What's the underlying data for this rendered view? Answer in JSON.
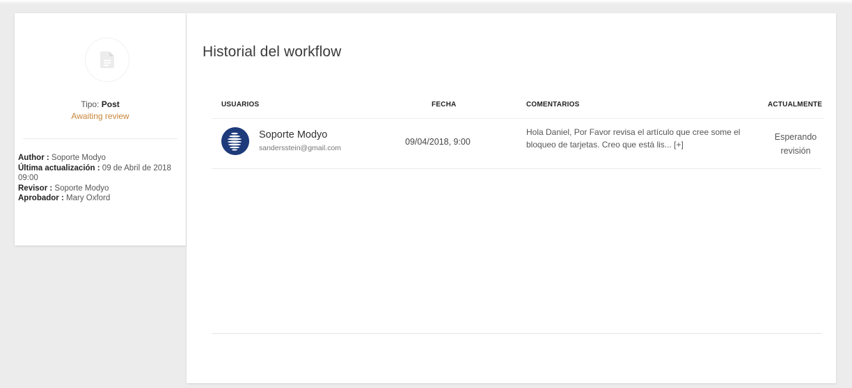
{
  "sidebar": {
    "tipo_label": "Tipo:",
    "tipo_value": "Post",
    "status": "Awaiting review",
    "meta": [
      {
        "label": "Author :",
        "value": "Soporte Modyo"
      },
      {
        "label": "Última actualización :",
        "value": "09 de Abril de 2018 09:00"
      },
      {
        "label": "Revisor :",
        "value": "Soporte Modyo"
      },
      {
        "label": "Aprobador :",
        "value": "Mary Oxford"
      }
    ],
    "icon": "document-icon"
  },
  "main": {
    "title": "Historial del workflow",
    "columns": {
      "usuarios": "USUARIOS",
      "fecha": "FECHA",
      "comentarios": "COMENTARIOS",
      "actualmente": "ACTUALMENTE"
    },
    "rows": [
      {
        "user_name": "Soporte Modyo",
        "user_email": "sandersstein@gmail.com",
        "fecha": "09/04/2018, 9:00",
        "comment": "Hola Daniel,  Por Favor revisa el artículo que cree some el bloqueo de tarjetas. Creo que está lis...",
        "more": "[+]",
        "status_line1": "Esperando",
        "status_line2": "revisión"
      }
    ]
  },
  "colors": {
    "accent_status": "#c9853a",
    "avatar_bg": "#1d3a7a",
    "background": "#ececec"
  }
}
